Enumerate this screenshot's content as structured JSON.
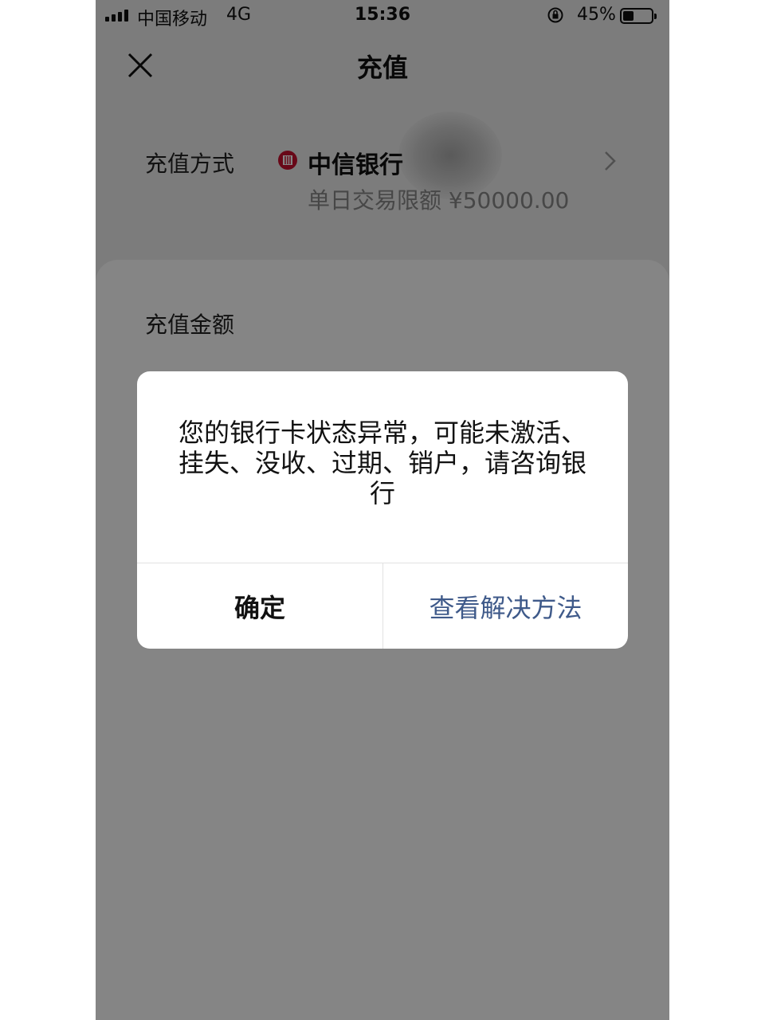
{
  "status_bar": {
    "carrier": "中国移动",
    "network": "4G",
    "time": "15:36",
    "battery": "45%",
    "battery_level": 0.45
  },
  "nav": {
    "title": "充值",
    "close_icon": "close-icon"
  },
  "payment": {
    "label": "充值方式",
    "bank_name": "中信银行",
    "daily_limit": "单日交易限额 ¥50000.00",
    "bank_color": "#c8102e"
  },
  "amount": {
    "label": "充值金额"
  },
  "dialog": {
    "message": "您的银行卡状态异常，可能未激活、挂失、没收、过期、销户，请咨询银行",
    "confirm_label": "确定",
    "solution_label": "查看解决方法",
    "solution_color": "#3f5a8a"
  }
}
